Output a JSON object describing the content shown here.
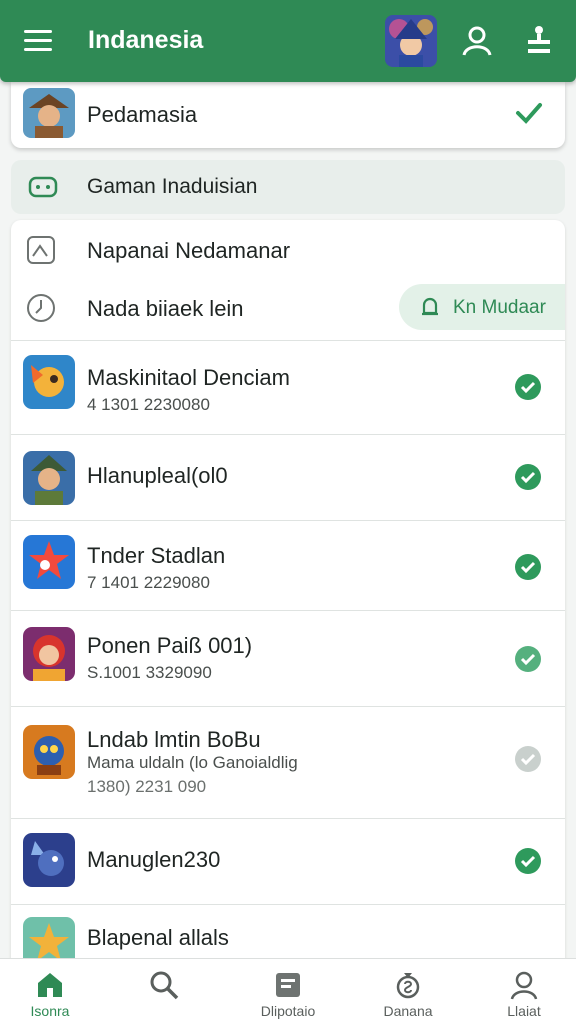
{
  "appbar": {
    "title": "Indanesia"
  },
  "pinned": {
    "label": "Pedamasia"
  },
  "section": {
    "label": "Gaman Inaduisian"
  },
  "options": [
    {
      "label": "Napanai Nedamanar",
      "icon": "image-icon"
    },
    {
      "label": "Nada biiaek lein",
      "icon": "clock-icon"
    }
  ],
  "pill": {
    "label": "Kn Mudaar"
  },
  "apps": [
    {
      "name": "Maskinitaol Denciam",
      "sub": "4 1301 2230080",
      "sub2": "",
      "state": "checked"
    },
    {
      "name": "Hlanupleal(ol0",
      "sub": "",
      "sub2": "",
      "state": "checked"
    },
    {
      "name": "Tnder Stadlan",
      "sub": "7 1401 2229080",
      "sub2": "",
      "state": "checked"
    },
    {
      "name": "Ponen Paiß 001)",
      "sub": "S.1001 3329090",
      "sub2": "",
      "state": "checked"
    },
    {
      "name": "Lndab lmtin BoBu",
      "sub": "Mama uldaln (lo Ganoialdlig",
      "sub2": "1380) 2231 090",
      "state": "disabled"
    },
    {
      "name": "Manuglen230",
      "sub": "",
      "sub2": "",
      "state": "checked"
    },
    {
      "name": "Blapenal allals",
      "sub": "",
      "sub2": "",
      "state": "none"
    }
  ],
  "tabs": [
    {
      "label": "Isonra",
      "icon": "home-icon"
    },
    {
      "label": "",
      "icon": "search-icon"
    },
    {
      "label": "Dlipotaio",
      "icon": "library-icon"
    },
    {
      "label": "Danana",
      "icon": "money-icon"
    },
    {
      "label": "Llaiat",
      "icon": "profile-icon"
    }
  ],
  "colors": {
    "primary": "#2f8a55",
    "check": "#2e9a5c",
    "disabled": "#c9d0cd"
  }
}
